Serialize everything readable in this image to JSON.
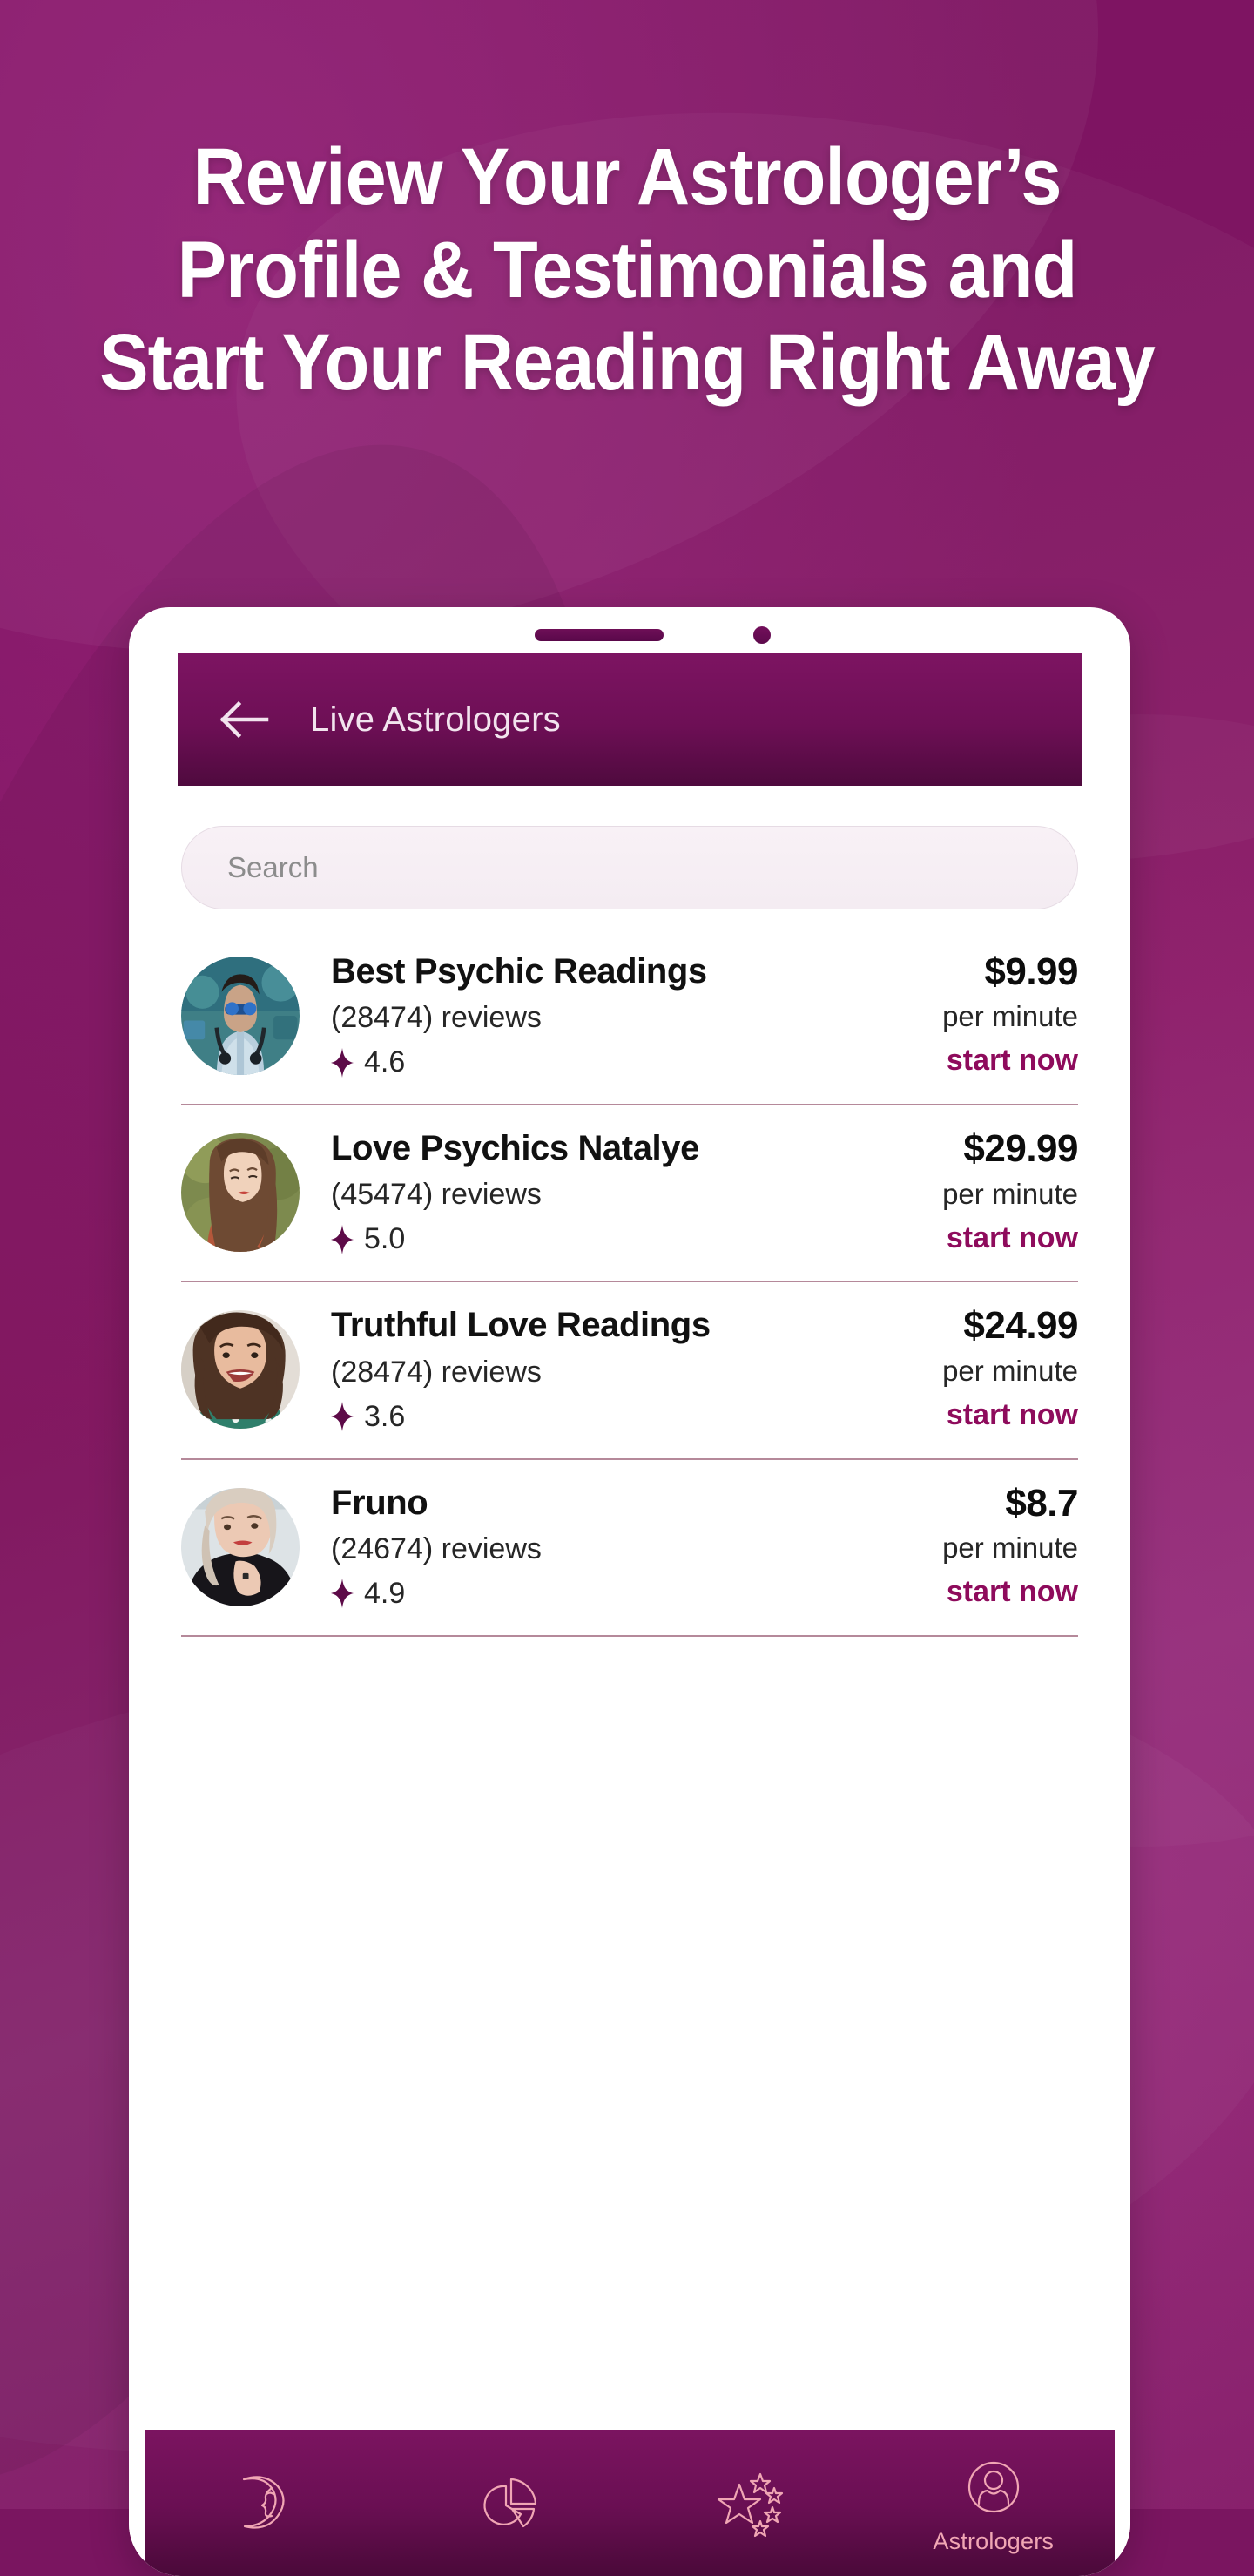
{
  "promo": {
    "headline_lines": [
      "Review Your Astrologer’s",
      "Profile & Testimonials and",
      "Start Your Reading Right Away"
    ],
    "background_color": "#7d1462",
    "headline_color": "#ffffff"
  },
  "phone": {
    "speaker_icon": "speaker-slot",
    "camera_icon": "front-camera-dot"
  },
  "app": {
    "header": {
      "back_icon": "back-arrow-icon",
      "title": "Live Astrologers",
      "bar_color": "#6d0f55"
    },
    "search": {
      "placeholder": "Search",
      "value": ""
    },
    "list": {
      "rating_icon": "four-point-star-icon",
      "accent_color": "#8e0b5c",
      "items": [
        {
          "avatar_icon": "avatar-photo-man-sunglasses-headphones",
          "name": "Best Psychic Readings",
          "reviews": "(28474) reviews",
          "rating": "4.6",
          "price": "$9.99",
          "rate_unit": "per minute",
          "cta": "start now"
        },
        {
          "avatar_icon": "avatar-photo-woman-long-brown-hair",
          "name": "Love Psychics Natalye",
          "reviews": "(45474) reviews",
          "rating": "5.0",
          "price": "$29.99",
          "rate_unit": "per minute",
          "cta": "start now"
        },
        {
          "avatar_icon": "avatar-photo-smiling-woman-curly-hair",
          "name": "Truthful Love Readings",
          "reviews": "(28474) reviews",
          "rating": "3.6",
          "price": "$24.99",
          "rate_unit": "per minute",
          "cta": "start now"
        },
        {
          "avatar_icon": "avatar-photo-blonde-woman-black-top",
          "name": "Fruno",
          "reviews": "(24674) reviews",
          "rating": "4.9",
          "price": "$8.7",
          "rate_unit": "per minute",
          "cta": "start now"
        }
      ]
    },
    "bottom_nav": {
      "icon_color": "#f0a6b4",
      "items": [
        {
          "icon": "crescent-moon-face-icon",
          "label": "",
          "active": false
        },
        {
          "icon": "pie-chart-wheel-icon",
          "label": "",
          "active": false
        },
        {
          "icon": "star-cluster-icon",
          "label": "",
          "active": false
        },
        {
          "icon": "person-circle-icon",
          "label": "Astrologers",
          "active": true
        }
      ]
    }
  }
}
